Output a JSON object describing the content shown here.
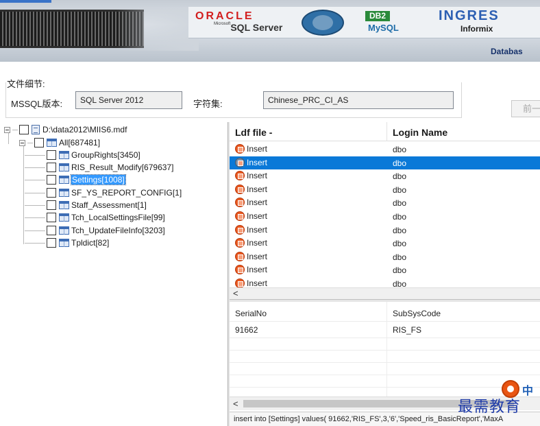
{
  "banner": {
    "logos": [
      "ORACLE",
      "SQL Server",
      "DB2",
      "MySQL",
      "INGRES",
      "Informix"
    ],
    "sql_prefix": "Microsoft",
    "database_text": "Databas"
  },
  "file_detail": {
    "title": "文件细节:",
    "mssql_version_label": "MSSQL版本:",
    "mssql_version_value": "SQL Server 2012",
    "charset_label": "字符集:",
    "charset_value": "Chinese_PRC_CI_AS",
    "prev_button": "前一"
  },
  "tree": {
    "root": "D:\\data2012\\MIIS6.mdf",
    "all": "All[687481]",
    "tables": [
      "GroupRights[3450]",
      "RIS_Result_Modify[679637]",
      "Settings[1008]",
      "SF_YS_REPORT_CONFIG[1]",
      "Staff_Assessment[1]",
      "Tch_LocalSettingsFile[99]",
      "Tch_UpdateFileInfo[3203]",
      "Tpldict[82]"
    ],
    "selected_index": 2
  },
  "log_grid": {
    "columns": [
      "Ldf file -",
      "Login Name"
    ],
    "rows": [
      {
        "op": "Insert",
        "login": "dbo"
      },
      {
        "op": "Insert",
        "login": "dbo"
      },
      {
        "op": "Insert",
        "login": "dbo"
      },
      {
        "op": "Insert",
        "login": "dbo"
      },
      {
        "op": "Insert",
        "login": "dbo"
      },
      {
        "op": "Insert",
        "login": "dbo"
      },
      {
        "op": "Insert",
        "login": "dbo"
      },
      {
        "op": "Insert",
        "login": "dbo"
      },
      {
        "op": "Insert",
        "login": "dbo"
      },
      {
        "op": "Insert",
        "login": "dbo"
      },
      {
        "op": "Insert",
        "login": "dbo"
      }
    ],
    "selected_index": 1
  },
  "scroll_left_glyph": "<",
  "record_detail": {
    "columns": [
      "SerialNo",
      "SubSysCode"
    ],
    "values": [
      "91662",
      "RIS_FS"
    ]
  },
  "sql_statement": "insert into [Settings] values( 91662,'RIS_FS',3,'6','Speed_ris_BasicReport','MaxA",
  "watermark": {
    "logo_char": "中",
    "text": "最需教育"
  },
  "colors": {
    "selection_tree": "#3399ff",
    "selection_grid": "#0a79d8",
    "op_icon": "#e9581f",
    "watermark": "#1d3aa8"
  }
}
